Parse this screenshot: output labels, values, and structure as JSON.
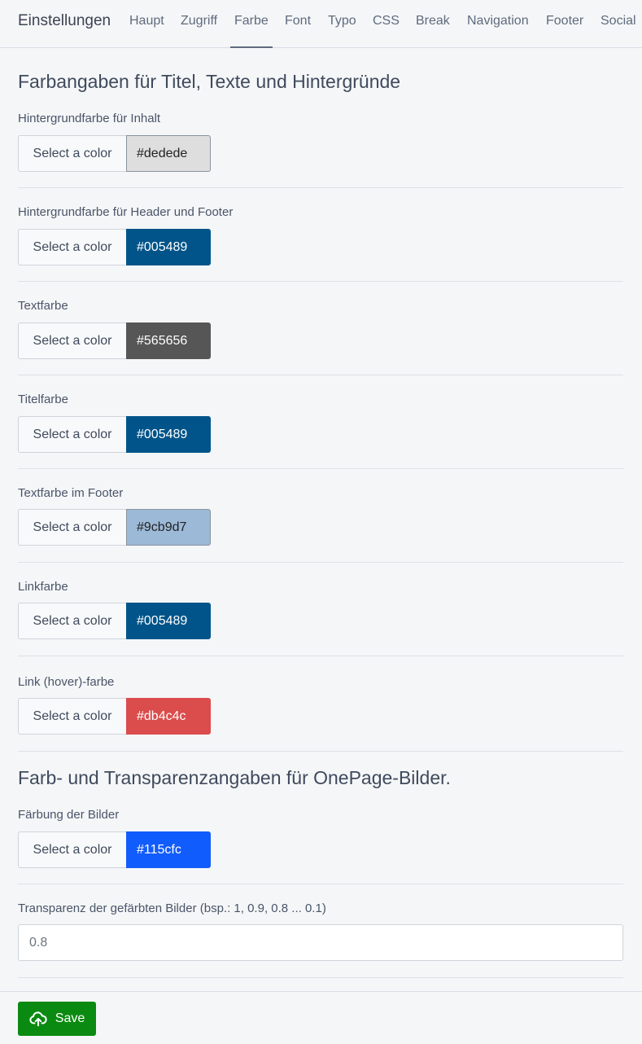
{
  "nav": {
    "brand": "Einstellungen",
    "tabs": [
      {
        "label": "Haupt"
      },
      {
        "label": "Zugriff"
      },
      {
        "label": "Farbe"
      },
      {
        "label": "Font"
      },
      {
        "label": "Typo"
      },
      {
        "label": "CSS"
      },
      {
        "label": "Break"
      },
      {
        "label": "Navigation"
      },
      {
        "label": "Footer"
      },
      {
        "label": "Social"
      }
    ],
    "active_tab": "Farbe"
  },
  "section1": {
    "title": "Farbangaben für Titel, Texte und Hintergründe",
    "fields": [
      {
        "label": "Hintergrundfarbe für Inhalt",
        "button": "Select a color",
        "value": "#dedede",
        "text_color": "#222222"
      },
      {
        "label": "Hintergrundfarbe für Header und Footer",
        "button": "Select a color",
        "value": "#005489",
        "text_color": "#ffffff"
      },
      {
        "label": "Textfarbe",
        "button": "Select a color",
        "value": "#565656",
        "text_color": "#ffffff"
      },
      {
        "label": "Titelfarbe",
        "button": "Select a color",
        "value": "#005489",
        "text_color": "#ffffff"
      },
      {
        "label": "Textfarbe im Footer",
        "button": "Select a color",
        "value": "#9cb9d7",
        "text_color": "#222222"
      },
      {
        "label": "Linkfarbe",
        "button": "Select a color",
        "value": "#005489",
        "text_color": "#ffffff"
      },
      {
        "label": "Link (hover)-farbe",
        "button": "Select a color",
        "value": "#db4c4c",
        "text_color": "#ffffff"
      }
    ]
  },
  "section2": {
    "title": "Farb- und Transparenzangaben für OnePage-Bilder.",
    "fields": [
      {
        "label": "Färbung der Bilder",
        "button": "Select a color",
        "value": "#115cfc",
        "text_color": "#ffffff"
      }
    ],
    "transparency": {
      "label": "Transparenz der gefärbten Bilder (bsp.: 1, 0.9, 0.8 ... 0.1)",
      "value": "0.8"
    }
  },
  "footer": {
    "save_label": "Save",
    "save_color": "#0b8a12"
  }
}
